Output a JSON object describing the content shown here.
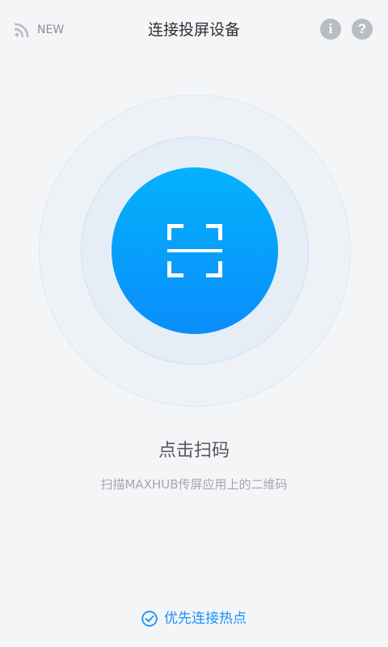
{
  "header": {
    "news_label": "NEW",
    "title": "连接投屏设备",
    "info_glyph": "i",
    "help_glyph": "?",
    "news_icon": "rss-icon",
    "info_icon": "info-icon",
    "help_icon": "help-icon"
  },
  "scan": {
    "icon": "scan-frame-icon",
    "title": "点击扫码",
    "subtitle": "扫描MAXHUB传屏应用上的二维码"
  },
  "hotspot": {
    "icon": "check-circle-icon",
    "label": "优先连接热点",
    "checked": true
  },
  "colors": {
    "background": "#f4f5f7",
    "accent": "#1a8ff7",
    "scan_gradient_top": "#04b2fd",
    "scan_gradient_bottom": "#0a8dfb",
    "header_icon_bg": "#b9bcc2"
  }
}
